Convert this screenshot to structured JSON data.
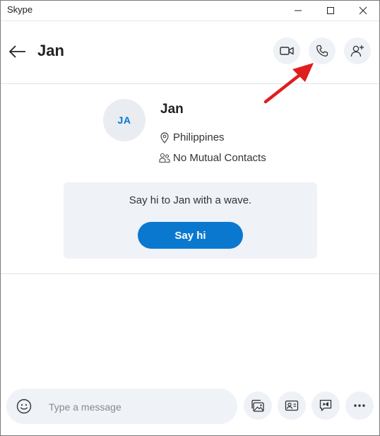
{
  "window": {
    "title": "Skype"
  },
  "header": {
    "title": "Jan",
    "actions": {
      "video_call": "video-camera-icon",
      "audio_call": "phone-icon",
      "add_person": "add-person-icon"
    }
  },
  "profile": {
    "initials": "JA",
    "name": "Jan",
    "location": "Philippines",
    "mutual_contacts": "No Mutual Contacts"
  },
  "wave": {
    "text": "Say hi to Jan with a wave.",
    "button_label": "Say hi"
  },
  "composer": {
    "placeholder": "Type a message"
  },
  "colors": {
    "accent": "#0b78d0",
    "annotation_arrow": "#e01e1e",
    "button_bg": "#eef1f5"
  }
}
